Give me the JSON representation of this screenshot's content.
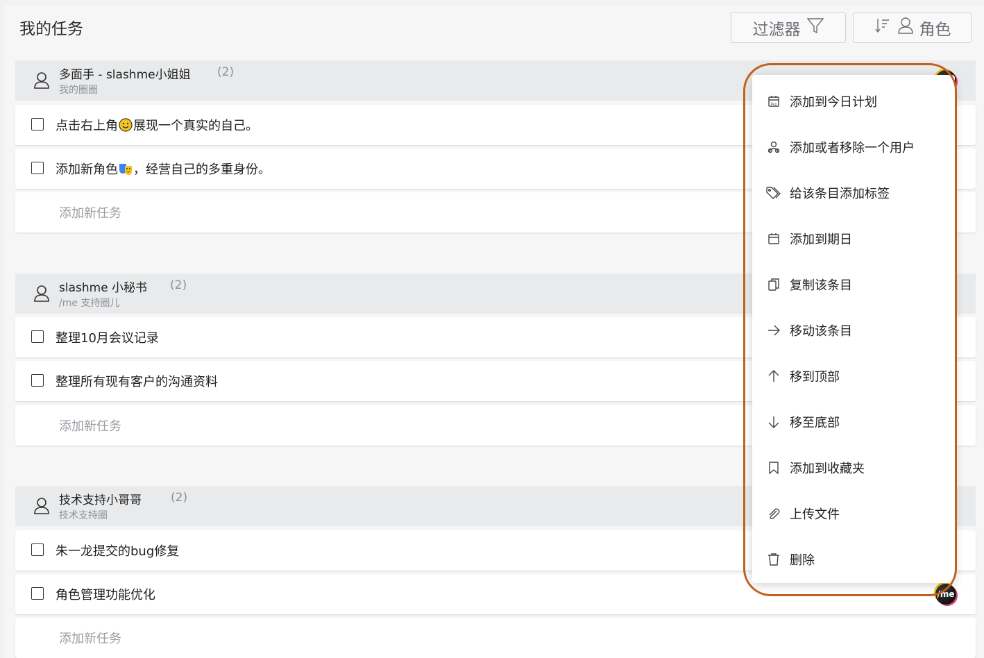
{
  "header": {
    "title": "我的任务",
    "filter_label": "过滤器",
    "sort_label": "角色"
  },
  "groups": [
    {
      "name": "多面手 - slashme小姐姐",
      "count": "(2)",
      "subtitle": "我的圈圈",
      "tasks": [
        {
          "before": "点击右上角",
          "after": "展现一个真实的自己。",
          "emoji": "smiley-emoji"
        },
        {
          "before": "添加新角色",
          "after": "，经营自己的多重身份。",
          "emoji": "masks-emoji"
        }
      ],
      "add_label": "添加新任务"
    },
    {
      "name": "slashme 小秘书",
      "count": "(2)",
      "subtitle": "/me 支持圈儿",
      "tasks": [
        {
          "text": "整理10月会议记录"
        },
        {
          "text": "整理所有现有客户的沟通资料"
        }
      ],
      "add_label": "添加新任务"
    },
    {
      "name": "技术支持小哥哥",
      "count": "(2)",
      "subtitle": "技术支持圈",
      "tasks": [
        {
          "text": "朱一龙提交的bug修复"
        },
        {
          "text": "角色管理功能优化"
        }
      ],
      "add_label": "添加新任务"
    }
  ],
  "avatar_text": "/me",
  "context_menu": {
    "items": [
      {
        "label": "添加到今日计划",
        "icon": "day-calendar-icon"
      },
      {
        "label": "添加或者移除一个用户",
        "icon": "users-icon"
      },
      {
        "label": "给该条目添加标签",
        "icon": "tag-icon"
      },
      {
        "label": "添加到期日",
        "icon": "calendar-icon"
      },
      {
        "label": "复制该条目",
        "icon": "copy-icon"
      },
      {
        "label": "移动该条目",
        "icon": "arrow-right-icon"
      },
      {
        "label": "移到顶部",
        "icon": "arrow-up-icon"
      },
      {
        "label": "移至底部",
        "icon": "arrow-down-icon"
      },
      {
        "label": "添加到收藏夹",
        "icon": "bookmark-icon"
      },
      {
        "label": "上传文件",
        "icon": "paperclip-icon"
      },
      {
        "label": "删除",
        "icon": "trash-icon"
      }
    ]
  },
  "colors": {
    "highlight": "#c2601d",
    "group_header_bg": "#e9eaec",
    "muted_text": "#9a9ea3"
  }
}
